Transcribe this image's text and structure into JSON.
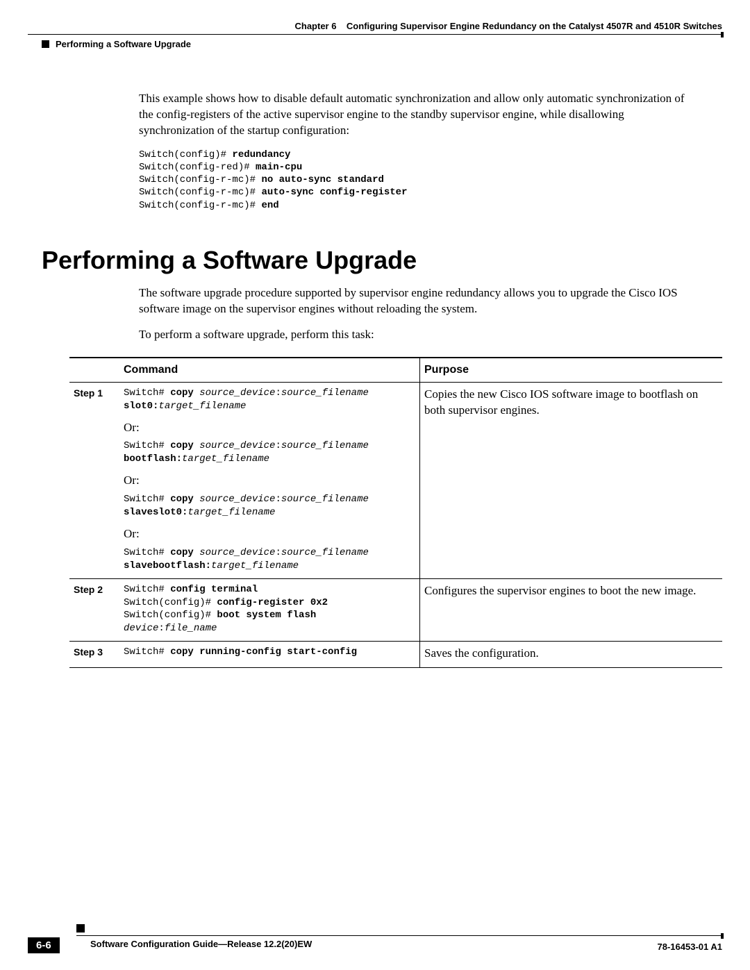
{
  "header": {
    "chapter": "Chapter 6",
    "title": "Configuring Supervisor Engine Redundancy on the Catalyst 4507R and 4510R Switches",
    "section": "Performing a Software Upgrade"
  },
  "intro_para": "This example shows how to disable default automatic synchronization and allow only automatic synchronization of the config-registers of the active supervisor engine to the standby supervisor engine, while disallowing synchronization of the startup configuration:",
  "code_example": {
    "l1p": "Switch(config)# ",
    "l1b": "redundancy",
    "l2p": "Switch(config-red)# ",
    "l2b": "main-cpu",
    "l3p": "Switch(config-r-mc)# ",
    "l3b": "no auto-sync standard",
    "l4p": "Switch(config-r-mc)# ",
    "l4b": "auto-sync config-register",
    "l5p": "Switch(config-r-mc)# ",
    "l5b": "end"
  },
  "section_heading": "Performing a Software Upgrade",
  "section_para1": "The software upgrade procedure supported by supervisor engine redundancy allows you to upgrade the Cisco IOS software image on the supervisor engines without reloading the system.",
  "section_para2": "To perform a software upgrade, perform this task:",
  "table": {
    "headers": {
      "command": "Command",
      "purpose": "Purpose"
    },
    "or_label": "Or:",
    "steps": [
      {
        "step": "Step 1",
        "cmd": {
          "variants": [
            {
              "p": "Switch# ",
              "c": "copy ",
              "a1": "source_device",
              "sep1": ":",
              "a2": "source_filename",
              "nl_b": "slot0:",
              "nl_i": "target_filename"
            },
            {
              "p": "Switch# ",
              "c": "copy ",
              "a1": "source_device",
              "sep1": ":",
              "a2": "source_filename",
              "nl_b": "bootflash:",
              "nl_i": "target_filename"
            },
            {
              "p": "Switch# ",
              "c": "copy ",
              "a1": "source_device",
              "sep1": ":",
              "a2": "source_filename",
              "nl_b": "slaveslot0:",
              "nl_i": "target_filename"
            },
            {
              "p": "Switch# ",
              "c": "copy ",
              "a1": "source_device",
              "sep1": ":",
              "a2": "source_filename",
              "nl_b": "slavebootflash:",
              "nl_i": "target_filename"
            }
          ]
        },
        "purpose": "Copies the new Cisco IOS software image to bootflash on both supervisor engines."
      },
      {
        "step": "Step 2",
        "cmd2": {
          "l1p": "Switch# ",
          "l1b": "config terminal",
          "l2p": "Switch(config)# ",
          "l2b": "config-register 0x2",
          "l3p": "Switch(config)# ",
          "l3b": "boot system flash",
          "l4i": "device",
          "l4t": ":",
          "l4i2": "file_name"
        },
        "purpose": "Configures the supervisor engines to boot the new image."
      },
      {
        "step": "Step 3",
        "cmd3": {
          "p": "Switch# ",
          "b": "copy running-config start-config"
        },
        "purpose": "Saves the configuration."
      }
    ]
  },
  "footer": {
    "guide": "Software Configuration Guide—Release 12.2(20)EW",
    "page": "6-6",
    "docnum": "78-16453-01 A1"
  }
}
